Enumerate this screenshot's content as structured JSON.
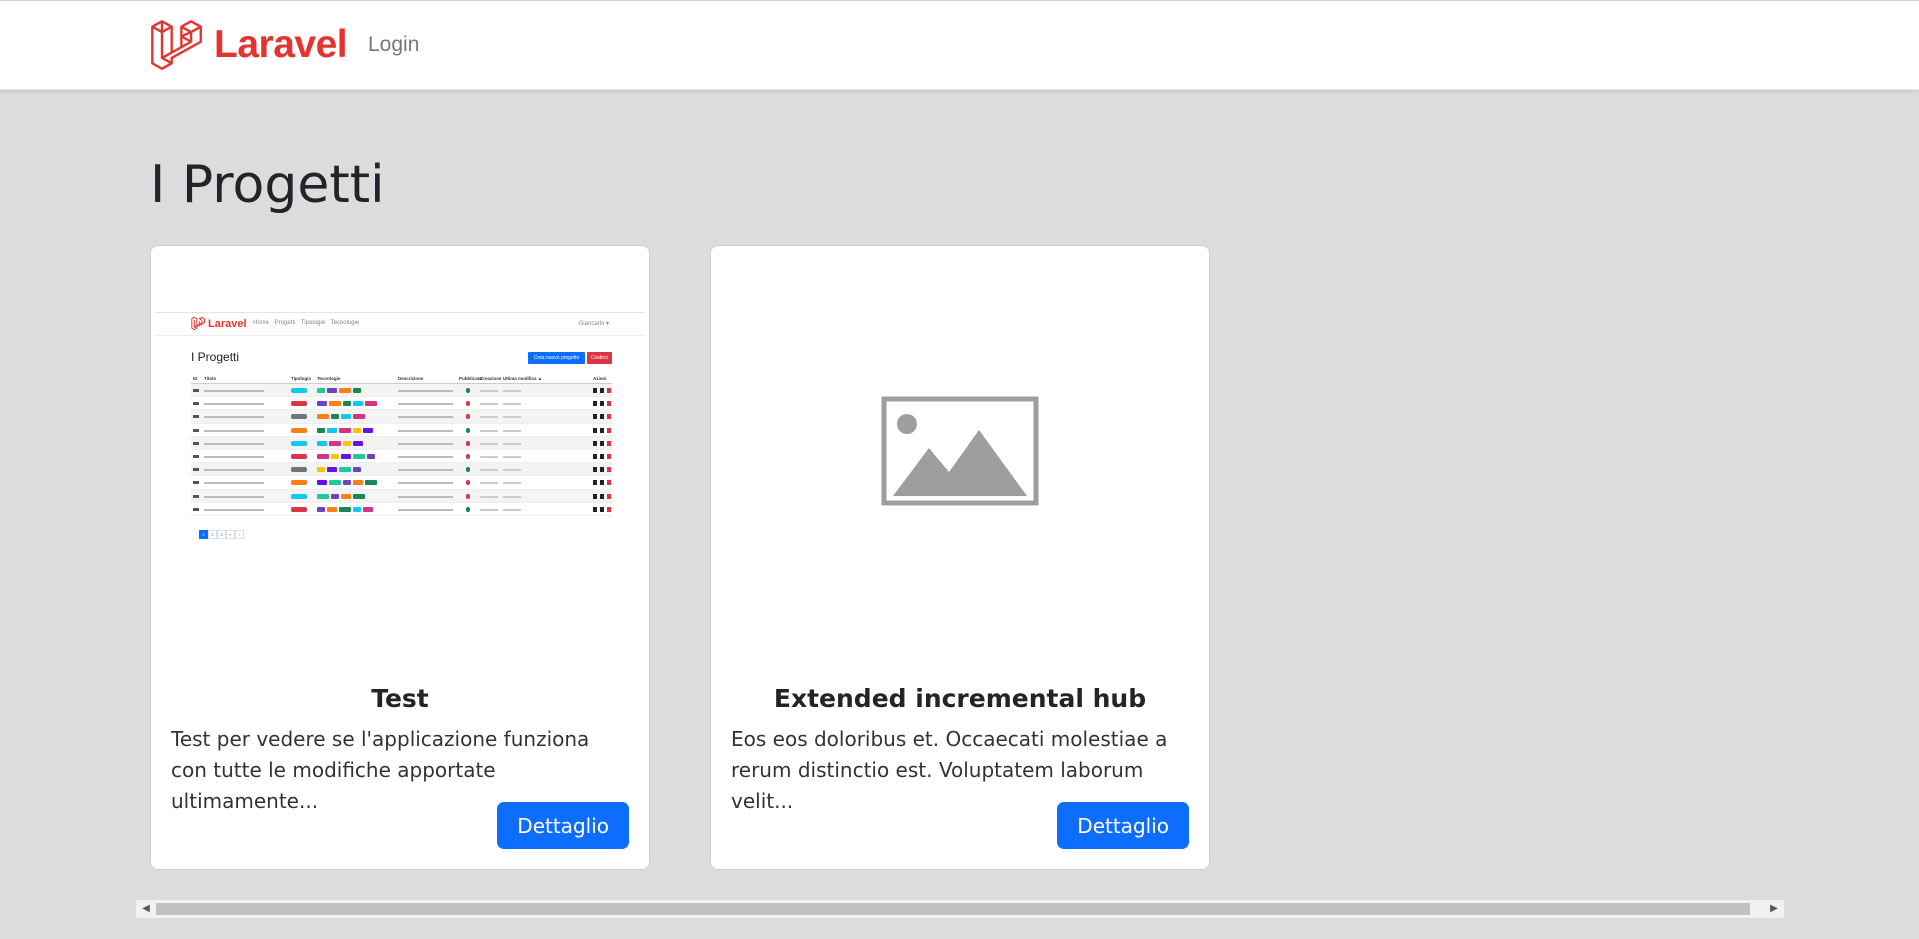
{
  "navbar": {
    "brand": "Laravel",
    "login": "Login"
  },
  "page": {
    "title": "I Progetti"
  },
  "projects": [
    {
      "title": "Test",
      "description": "Test per vedere se l'applicazione funziona con tutte le modifiche apportate ultimamente...",
      "button": "Dettaglio",
      "image": "screenshot-thumbnail"
    },
    {
      "title": "Extended incremental hub",
      "description": "Eos eos doloribus et. Occaecati molestiae a rerum distinctio est. Voluptatem laborum velit...",
      "button": "Dettaglio",
      "image": "image-placeholder-icon"
    }
  ],
  "thumbnail": {
    "brand": "Laravel",
    "nav_links": "Home Progetti Tipologie Tecnologie",
    "user_menu": "Giancarlo ▾",
    "title": "I Progetti",
    "new_button": "Crea nuovo progetto",
    "trash_button": "Cestino",
    "headers": [
      "ID",
      "Titolo",
      "Tipologia",
      "Tecnologie",
      "Descrizione",
      "Pubblicato",
      "Creazione",
      "Ultima modifica ▲",
      "Azioni"
    ],
    "row_ids": [
      "31",
      "40",
      "41",
      "51",
      "34",
      "46",
      "37",
      "55",
      "39",
      "40"
    ],
    "pages": [
      "1",
      "2",
      "3",
      "»",
      "›"
    ]
  },
  "scrollbar": {
    "left_arrow": "◀",
    "right_arrow": "▶"
  },
  "colors": {
    "brand": "#e3342f",
    "primary": "#0d6efd",
    "danger": "#dc3545",
    "background": "#dcdcdc",
    "placeholder_icon": "#9e9e9e"
  }
}
